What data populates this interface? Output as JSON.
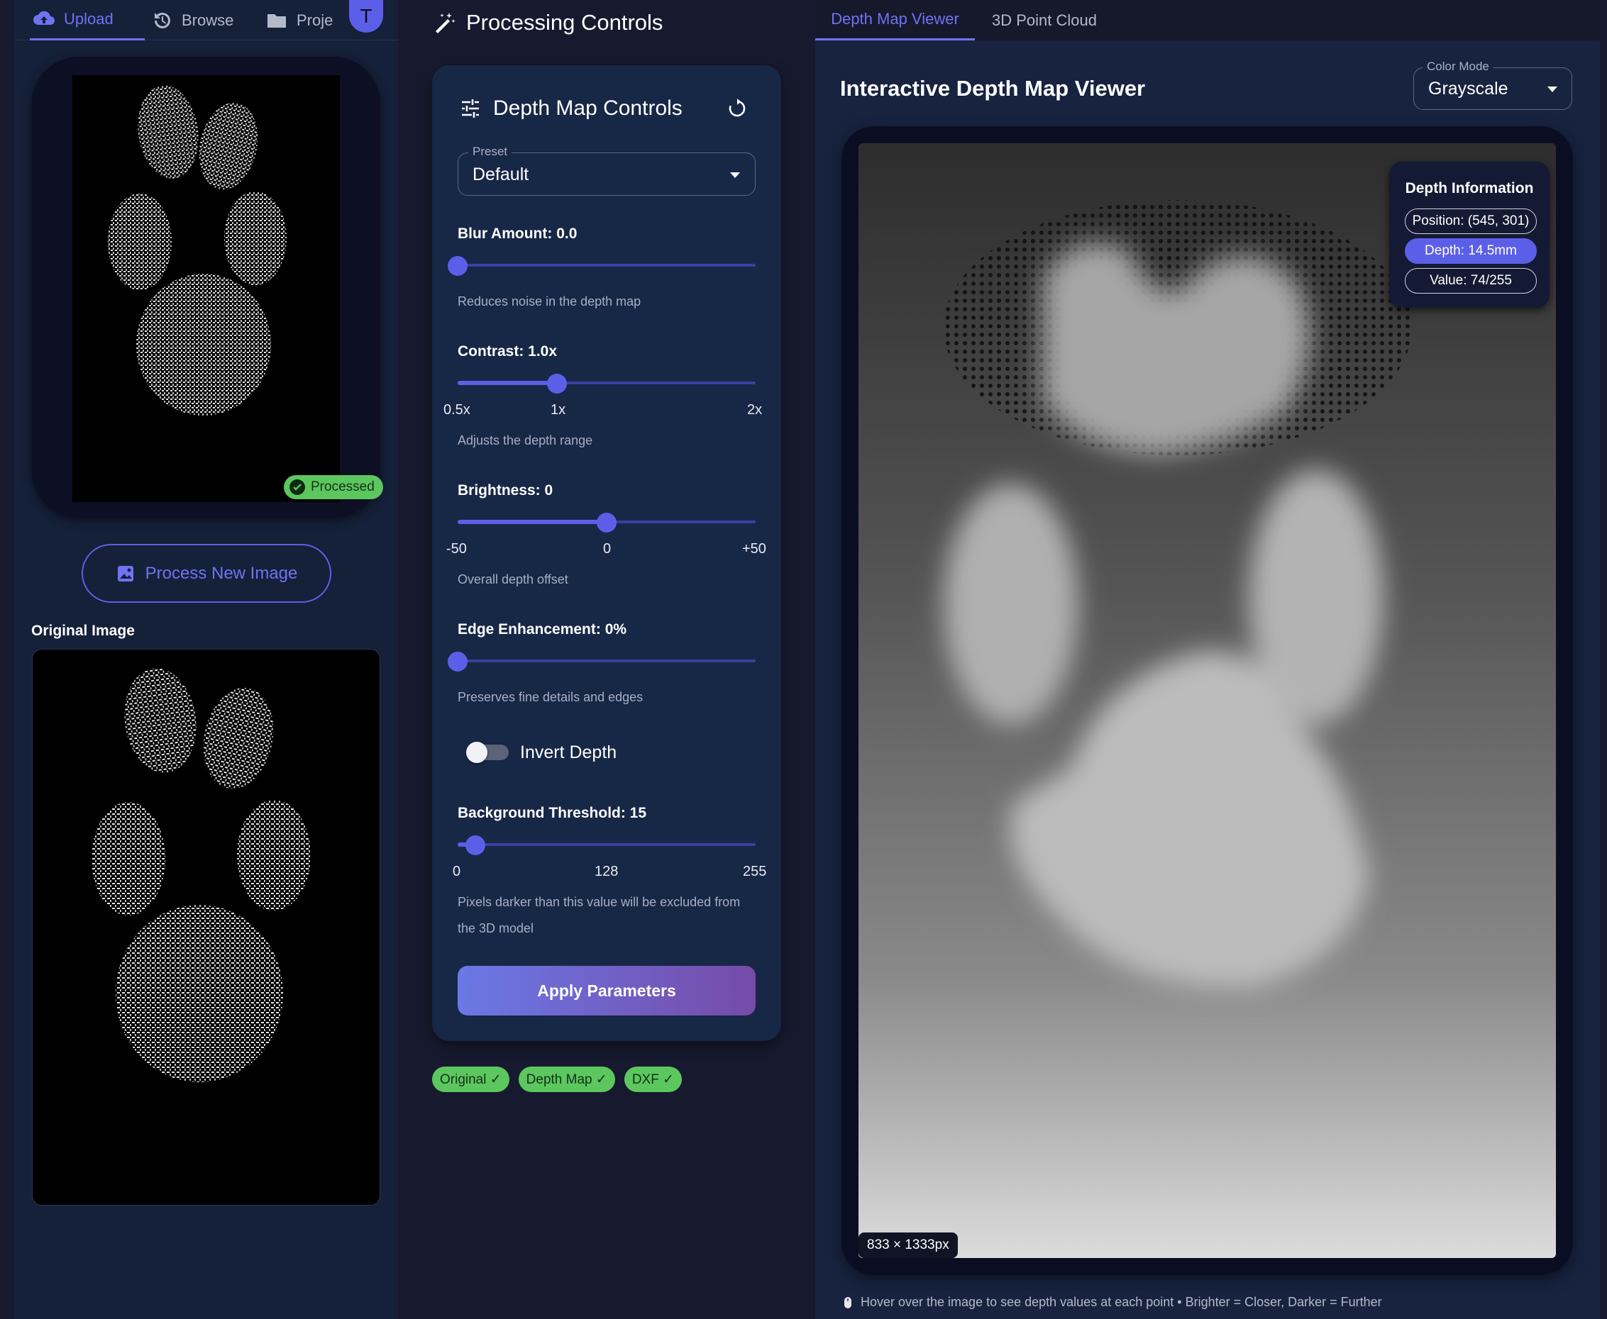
{
  "nav": {
    "tabs": [
      {
        "label": "Upload",
        "icon": "cloud-upload-icon"
      },
      {
        "label": "Browse",
        "icon": "history-icon"
      },
      {
        "label": "Proje",
        "icon": "folder-icon"
      }
    ],
    "avatar_initial": "T"
  },
  "left": {
    "processed_badge": "Processed",
    "process_button": "Process New Image",
    "original_label": "Original Image"
  },
  "controls": {
    "header": "Processing Controls",
    "card_title": "Depth Map Controls",
    "preset": {
      "legend": "Preset",
      "value": "Default"
    },
    "blur": {
      "label": "Blur Amount: 0.0",
      "desc": "Reduces noise in the depth map",
      "value": 0.0,
      "min": 0,
      "max": 10
    },
    "contrast": {
      "label": "Contrast: 1.0x",
      "desc": "Adjusts the depth range",
      "value": 1.0,
      "min": 0.5,
      "max": 2.0,
      "ticks": [
        "0.5x",
        "1x",
        "2x"
      ]
    },
    "brightness": {
      "label": "Brightness: 0",
      "desc": "Overall depth offset",
      "value": 0,
      "min": -50,
      "max": 50,
      "ticks": [
        "-50",
        "0",
        "+50"
      ]
    },
    "edge": {
      "label": "Edge Enhancement: 0%",
      "desc": "Preserves fine details and edges",
      "value": 0,
      "min": 0,
      "max": 100
    },
    "invert": {
      "label": "Invert Depth",
      "on": false
    },
    "threshold": {
      "label": "Background Threshold: 15",
      "desc": "Pixels darker than this value will be excluded from the 3D model",
      "value": 15,
      "min": 0,
      "max": 255,
      "ticks": [
        "0",
        "128",
        "255"
      ]
    },
    "apply_button": "Apply Parameters"
  },
  "status_chips": [
    "Original ✓",
    "Depth Map ✓",
    "DXF ✓"
  ],
  "viewer": {
    "tabs": [
      "Depth Map Viewer",
      "3D Point Cloud"
    ],
    "title": "Interactive Depth Map Viewer",
    "color_mode": {
      "legend": "Color Mode",
      "value": "Grayscale"
    },
    "info": {
      "title": "Depth Information",
      "position": "Position: (545, 301)",
      "depth": "Depth: 14.5mm",
      "value": "Value: 74/255"
    },
    "dimensions": "833 × 1333px",
    "hint": "Hover over the image to see depth values at each point • Brighter = Closer, Darker = Further"
  },
  "colors": {
    "accent": "#5b5fe8",
    "success": "#5cc75e",
    "panel": "#152039",
    "card": "#172746"
  }
}
